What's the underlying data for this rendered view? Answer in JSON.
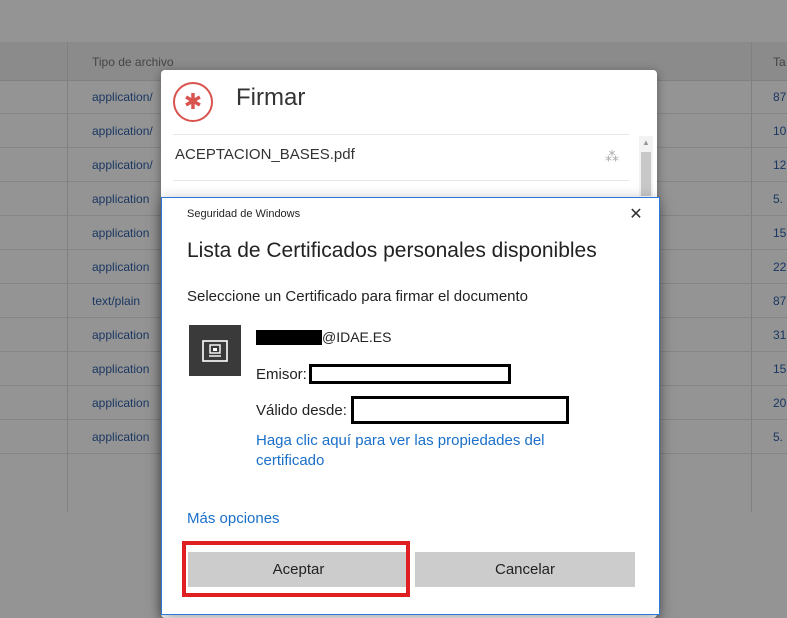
{
  "background_table": {
    "column_header": "Tipo de archivo",
    "size_header": "Ta",
    "rows": [
      {
        "type": "application/",
        "size": "87"
      },
      {
        "type": "application/",
        "size": "10"
      },
      {
        "type": "application/",
        "size": "12"
      },
      {
        "type": "application",
        "size": "5."
      },
      {
        "type": "application",
        "size": "15"
      },
      {
        "type": "application",
        "size": "22"
      },
      {
        "type": "text/plain",
        "size": "87"
      },
      {
        "type": "application",
        "size": "31"
      },
      {
        "type": "application",
        "size": "15"
      },
      {
        "type": "application",
        "size": "20"
      },
      {
        "type": "application",
        "size": "5."
      }
    ]
  },
  "firmar_dialog": {
    "title": "Firmar",
    "icon": "gear-icon",
    "file_name": "ACEPTACION_BASES.pdf",
    "spinner_icon": "spinner-icon",
    "accent_color": "#d9534f"
  },
  "security_dialog": {
    "caption": "Seguridad de Windows",
    "close_glyph": "✕",
    "heading": "Lista de Certificados personales disponibles",
    "instruction": "Seleccione un Certificado para firmar el documento",
    "certificate": {
      "icon": "certificate-icon",
      "name_suffix": "@IDAE.ES",
      "issuer_label": "Emisor:",
      "valid_from_label": "Válido desde:",
      "properties_link": "Haga clic aquí para ver las propiedades del certificado"
    },
    "more_options": "Más opciones",
    "accept_label": "Aceptar",
    "cancel_label": "Cancelar",
    "link_color": "#1a6fc9",
    "highlight_color": "#e02020"
  }
}
